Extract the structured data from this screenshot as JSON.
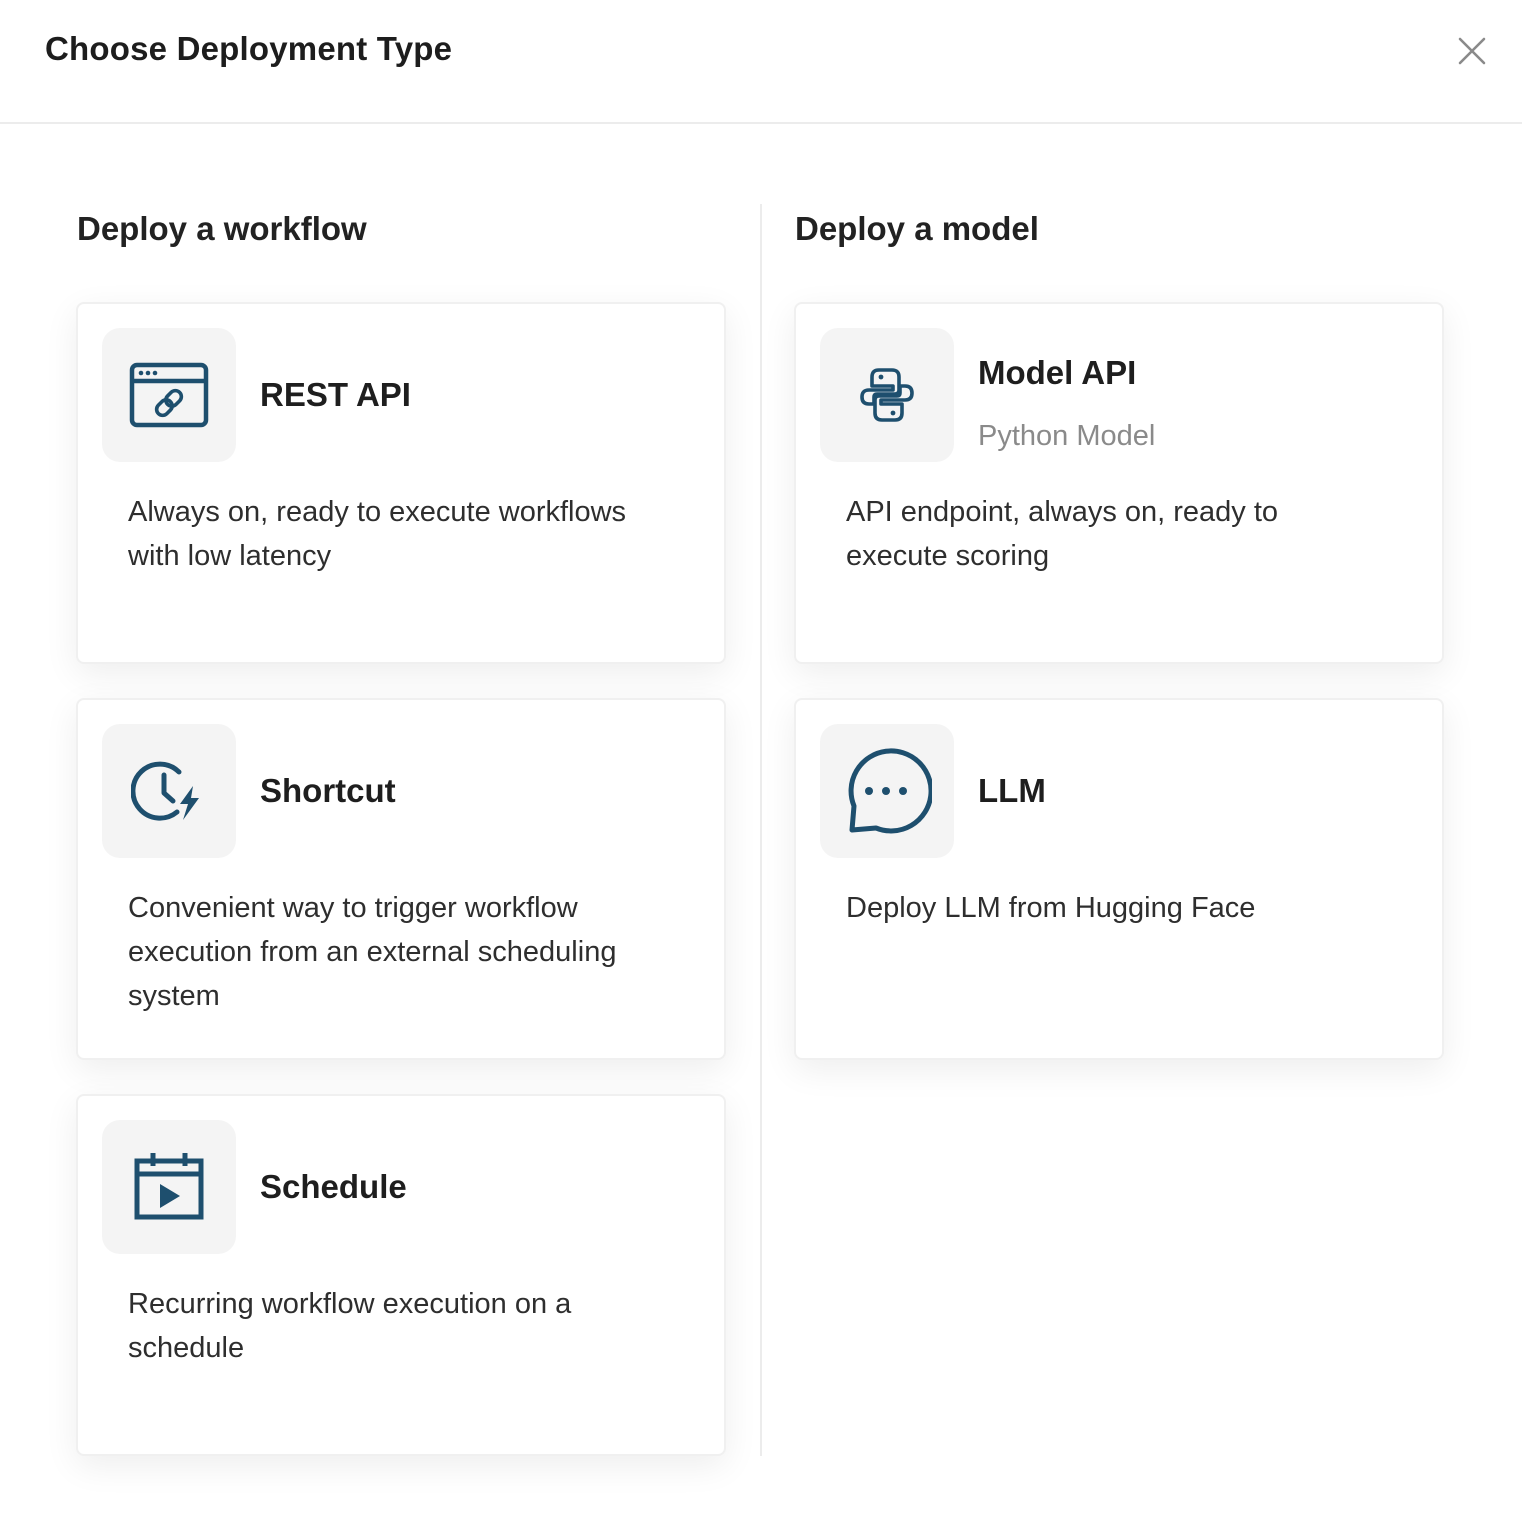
{
  "dialog": {
    "title": "Choose Deployment Type",
    "close_icon": "close-icon"
  },
  "workflow": {
    "heading": "Deploy a workflow",
    "cards": [
      {
        "title": "REST API",
        "description": "Always on, ready to execute workflows with low latency",
        "icon": "browser-link-icon"
      },
      {
        "title": "Shortcut",
        "description": "Convenient way to trigger workflow execution from an external scheduling system",
        "icon": "clock-lightning-icon"
      },
      {
        "title": "Schedule",
        "description": "Recurring workflow execution on a schedule",
        "icon": "calendar-play-icon"
      }
    ]
  },
  "model": {
    "heading": "Deploy a model",
    "cards": [
      {
        "title": "Model API",
        "subtitle": "Python Model",
        "description": "API endpoint, always on, ready to execute scoring",
        "icon": "python-icon"
      },
      {
        "title": "LLM",
        "description": "Deploy LLM from Hugging Face",
        "icon": "chat-bubble-icon"
      }
    ]
  },
  "colors": {
    "icon": "#1e4f6e",
    "icon_bg": "#f4f4f4",
    "subtitle": "#8a8a8a"
  }
}
